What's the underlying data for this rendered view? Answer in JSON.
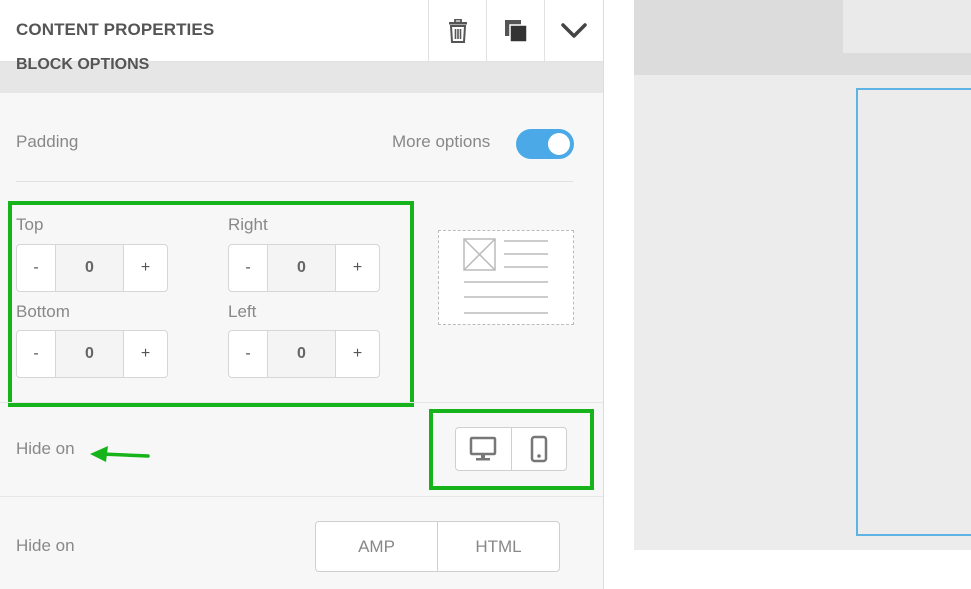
{
  "header": {
    "title": "CONTENT PROPERTIES",
    "icons": [
      "trash-icon",
      "duplicate-icon",
      "chevron-down-icon"
    ]
  },
  "section": {
    "title": "BLOCK OPTIONS"
  },
  "padding": {
    "label": "Padding",
    "more_options_label": "More options",
    "more_options_enabled": true,
    "fields": {
      "top": {
        "label": "Top",
        "value": "0",
        "minus": "-",
        "plus": "+"
      },
      "right": {
        "label": "Right",
        "value": "0",
        "minus": "-",
        "plus": "+"
      },
      "bottom": {
        "label": "Bottom",
        "value": "0",
        "minus": "-",
        "plus": "+"
      },
      "left": {
        "label": "Left",
        "value": "0",
        "minus": "-",
        "plus": "+"
      }
    }
  },
  "hide_on_device": {
    "label": "Hide on",
    "options": [
      "desktop-icon",
      "mobile-icon"
    ]
  },
  "hide_on_format": {
    "label": "Hide on",
    "options": [
      "AMP",
      "HTML"
    ]
  },
  "colors": {
    "highlight": "#17b31b",
    "toggle": "#4aa9e6",
    "selection": "#5fb2e4"
  }
}
